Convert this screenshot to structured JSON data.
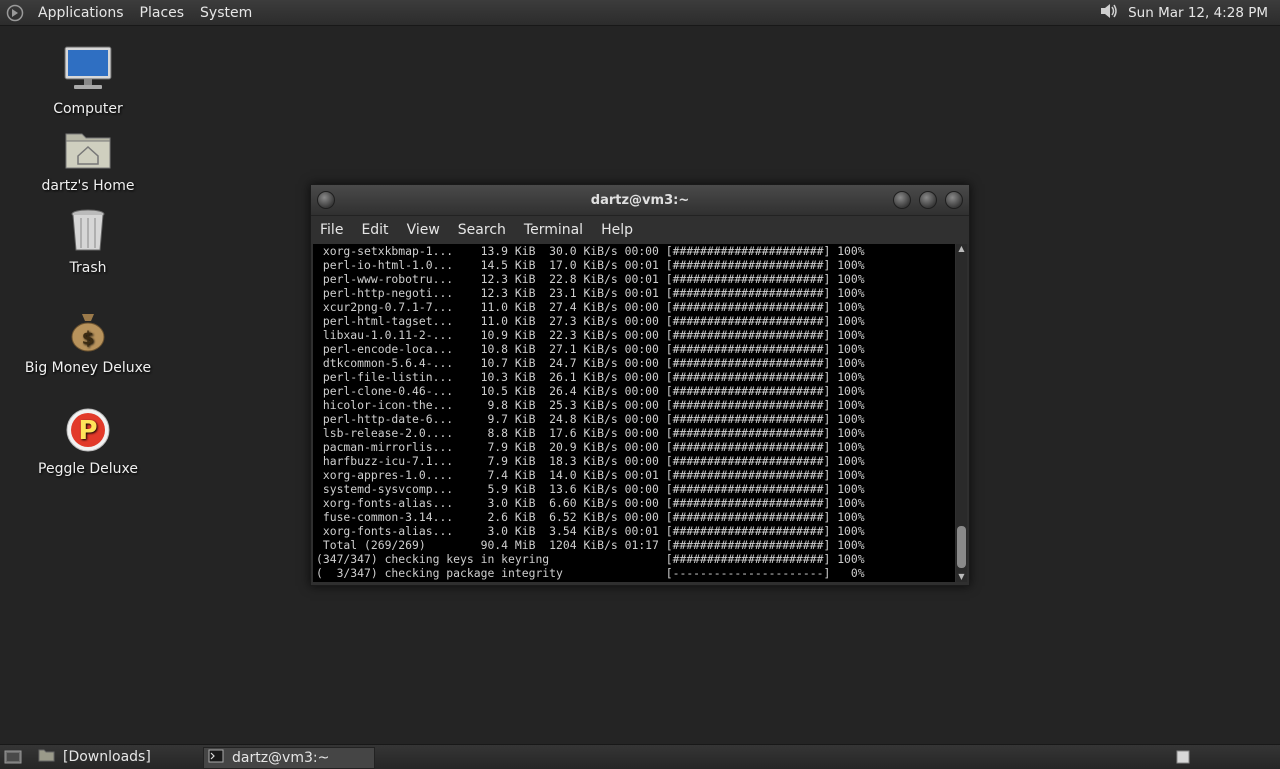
{
  "top_panel": {
    "menus": [
      "Applications",
      "Places",
      "System"
    ],
    "clock": "Sun Mar 12,  4:28 PM",
    "volume_icon": "speaker-icon"
  },
  "desktop_icons": [
    {
      "label": "Computer",
      "icon": "computer-icon"
    },
    {
      "label": "dartz's Home",
      "icon": "home-folder-icon"
    },
    {
      "label": "Trash",
      "icon": "trash-icon"
    },
    {
      "label": "Big Money Deluxe",
      "icon": "money-bag-icon"
    },
    {
      "label": "Peggle Deluxe",
      "icon": "peggle-icon"
    }
  ],
  "terminal": {
    "title": "dartz@vm3:~",
    "menus": [
      "File",
      "Edit",
      "View",
      "Search",
      "Terminal",
      "Help"
    ],
    "lines": [
      " xorg-setxkbmap-1...    13.9 KiB  30.0 KiB/s 00:00 [######################] 100%",
      " perl-io-html-1.0...    14.5 KiB  17.0 KiB/s 00:01 [######################] 100%",
      " perl-www-robotru...    12.3 KiB  22.8 KiB/s 00:01 [######################] 100%",
      " perl-http-negoti...    12.3 KiB  23.1 KiB/s 00:01 [######################] 100%",
      " xcur2png-0.7.1-7...    11.0 KiB  27.4 KiB/s 00:00 [######################] 100%",
      " perl-html-tagset...    11.0 KiB  27.3 KiB/s 00:00 [######################] 100%",
      " libxau-1.0.11-2-...    10.9 KiB  22.3 KiB/s 00:00 [######################] 100%",
      " perl-encode-loca...    10.8 KiB  27.1 KiB/s 00:00 [######################] 100%",
      " dtkcommon-5.6.4-...    10.7 KiB  24.7 KiB/s 00:00 [######################] 100%",
      " perl-file-listin...    10.3 KiB  26.1 KiB/s 00:00 [######################] 100%",
      " perl-clone-0.46-...    10.5 KiB  26.4 KiB/s 00:00 [######################] 100%",
      " hicolor-icon-the...     9.8 KiB  25.3 KiB/s 00:00 [######################] 100%",
      " perl-http-date-6...     9.7 KiB  24.8 KiB/s 00:00 [######################] 100%",
      " lsb-release-2.0....     8.8 KiB  17.6 KiB/s 00:00 [######################] 100%",
      " pacman-mirrorlis...     7.9 KiB  20.9 KiB/s 00:00 [######################] 100%",
      " harfbuzz-icu-7.1...     7.9 KiB  18.3 KiB/s 00:00 [######################] 100%",
      " xorg-appres-1.0....     7.4 KiB  14.0 KiB/s 00:01 [######################] 100%",
      " systemd-sysvcomp...     5.9 KiB  13.6 KiB/s 00:00 [######################] 100%",
      " xorg-fonts-alias...     3.0 KiB  6.60 KiB/s 00:00 [######################] 100%",
      " fuse-common-3.14...     2.6 KiB  6.52 KiB/s 00:00 [######################] 100%",
      " xorg-fonts-alias...     3.0 KiB  3.54 KiB/s 00:01 [######################] 100%",
      " Total (269/269)        90.4 MiB  1204 KiB/s 01:17 [######################] 100%",
      "(347/347) checking keys in keyring                 [######################] 100%",
      "(  3/347) checking package integrity               [----------------------]   0%"
    ]
  },
  "bottom_panel": {
    "tasks": [
      {
        "label": "[Downloads]",
        "icon": "folder-icon"
      },
      {
        "label": "dartz@vm3:~",
        "icon": "terminal-icon"
      }
    ],
    "show_desktop_icon": "workspace-icon"
  }
}
